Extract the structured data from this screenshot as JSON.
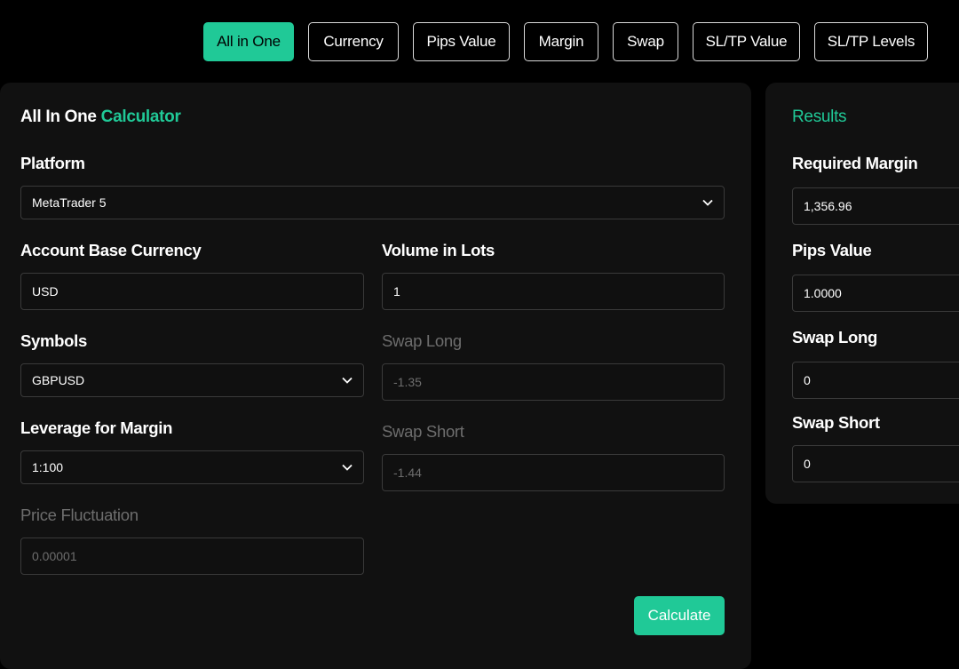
{
  "tabs": [
    "All in One",
    "Currency",
    "Pips Value",
    "Margin",
    "Swap",
    "SL/TP Value",
    "SL/TP Levels"
  ],
  "active_tab": "All in One",
  "calculator": {
    "title_main": "All In One",
    "title_accent": "Calculator",
    "platform": {
      "label": "Platform",
      "value": "MetaTrader 5"
    },
    "account_base_currency": {
      "label": "Account Base Currency",
      "value": "USD"
    },
    "volume_in_lots": {
      "label": "Volume in Lots",
      "value": "1"
    },
    "symbols": {
      "label": "Symbols",
      "value": "GBPUSD"
    },
    "swap_long": {
      "label": "Swap Long",
      "value": "-1.35"
    },
    "leverage_for_margin": {
      "label": "Leverage for Margin",
      "value": "1:100"
    },
    "swap_short": {
      "label": "Swap Short",
      "value": "-1.44"
    },
    "price_fluctuation": {
      "label": "Price Fluctuation",
      "value": "0.00001"
    },
    "calculate_label": "Calculate"
  },
  "results": {
    "title": "Results",
    "required_margin": {
      "label": "Required Margin",
      "value": "1,356.96"
    },
    "pips_value": {
      "label": "Pips Value",
      "value": "1.0000"
    },
    "swap_long": {
      "label": "Swap Long",
      "value": "0"
    },
    "swap_short": {
      "label": "Swap Short",
      "value": "0"
    }
  },
  "colors": {
    "accent": "#20c997",
    "panel": "#111111",
    "background": "#000000",
    "muted": "#6d6d6d"
  }
}
